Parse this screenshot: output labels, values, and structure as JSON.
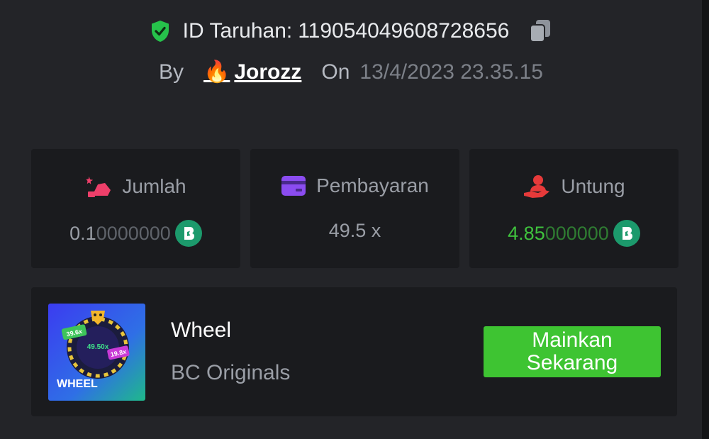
{
  "bet": {
    "id_label": "ID Taruhan:",
    "id_value": "119054049608728656",
    "by_label": "By",
    "user_emoji": "🔥",
    "username": "Jorozz",
    "on_label": "On",
    "date": "13/4/2023 23.35.15"
  },
  "stats": {
    "amount": {
      "label": "Jumlah",
      "value_main": "0.1",
      "value_dim": "0000000",
      "icon": "bet-hand-icon"
    },
    "payout": {
      "label": "Pembayaran",
      "value": "49.5 x",
      "icon": "card-icon"
    },
    "profit": {
      "label": "Untung",
      "value_main": "4.85",
      "value_dim": "000000",
      "icon": "profit-hand-icon"
    }
  },
  "game": {
    "title": "Wheel",
    "provider": "BC Originals",
    "play_label": "Mainkan Sekarang",
    "thumb_text": "WHEEL",
    "thumb_multipliers": [
      "39.6x",
      "49.50x",
      "19.8x"
    ]
  },
  "colors": {
    "background": "#232428",
    "card": "#1a1b1e",
    "accent_green": "#3ec432",
    "coin": "#1c9a6c"
  }
}
